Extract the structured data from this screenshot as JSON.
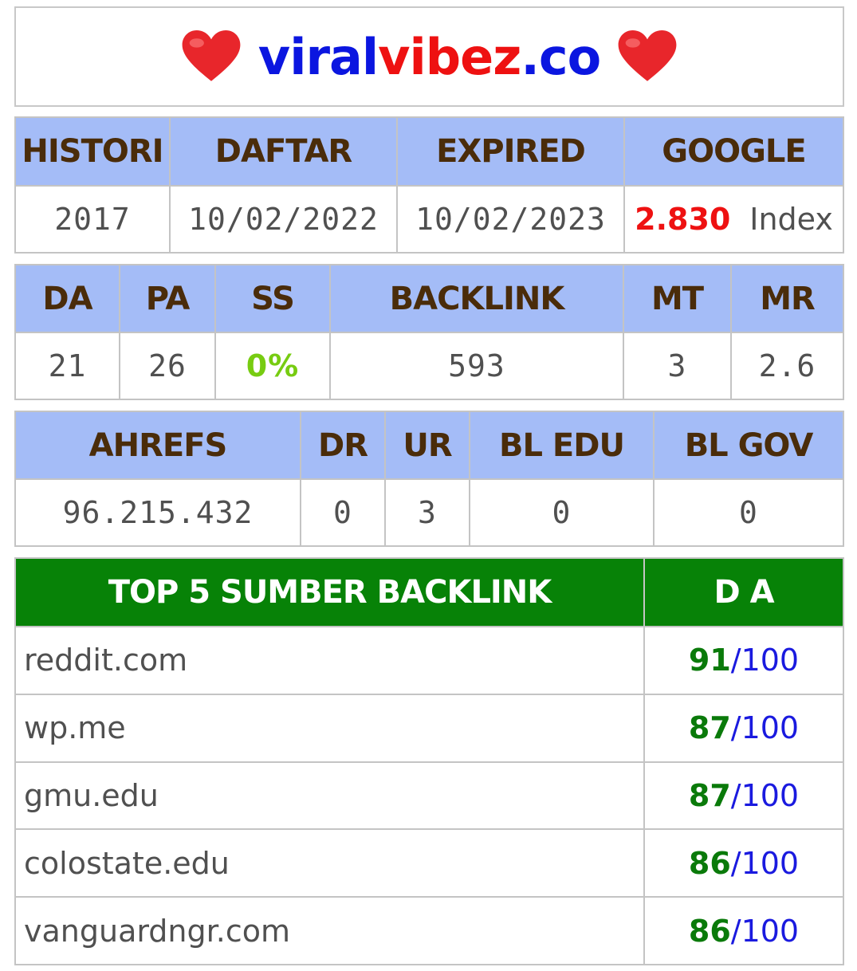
{
  "header": {
    "site_part1": "viral",
    "site_part2": "vibez",
    "site_part3": ".co",
    "heart_color": "#e8262b"
  },
  "table1": {
    "headers": [
      "HISTORI",
      "DAFTAR",
      "EXPIRED",
      "GOOGLE"
    ],
    "histori": "2017",
    "daftar": "10/02/2022",
    "expired": "10/02/2023",
    "google_count": "2.830",
    "google_unit": "Index"
  },
  "table2": {
    "headers": [
      "DA",
      "PA",
      "SS",
      "BACKLINK",
      "MT",
      "MR"
    ],
    "values": [
      "21",
      "26",
      "0%",
      "593",
      "3",
      "2.6"
    ]
  },
  "table3": {
    "headers": [
      "AHREFS",
      "DR",
      "UR",
      "BL EDU",
      "BL GOV"
    ],
    "values": [
      "96.215.432",
      "0",
      "3",
      "0",
      "0"
    ]
  },
  "table4": {
    "header_source": "TOP 5 SUMBER BACKLINK",
    "header_da": "D A",
    "rows": [
      {
        "domain": "reddit.com",
        "da": "91",
        "max": "100"
      },
      {
        "domain": "wp.me",
        "da": "87",
        "max": "100"
      },
      {
        "domain": "gmu.edu",
        "da": "87",
        "max": "100"
      },
      {
        "domain": "colostate.edu",
        "da": "86",
        "max": "100"
      },
      {
        "domain": "vanguardngr.com",
        "da": "86",
        "max": "100"
      }
    ]
  },
  "colors": {
    "header_blue": "#a4bcf7",
    "header_green": "#078207",
    "brand_blue": "#0b16e0",
    "brand_red": "#ee1111",
    "ss_green": "#77cc11"
  }
}
